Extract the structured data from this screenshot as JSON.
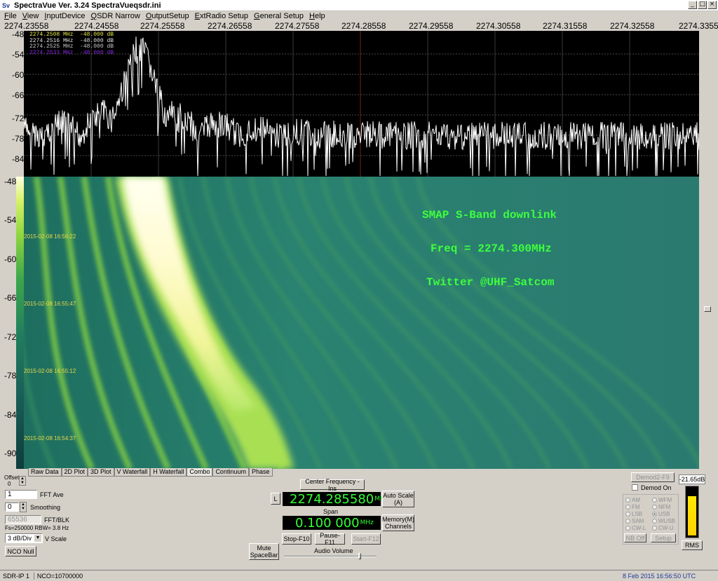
{
  "window": {
    "title": "SpectraVue Ver. 3.24  SpectraVueqsdr.ini",
    "icon_text": "Sv"
  },
  "menu": [
    "File",
    "View",
    "InputDevice",
    "QSDR Narrow",
    "OutputSetup",
    "ExtRadio Setup",
    "General Setup",
    "Help"
  ],
  "freq_axis": [
    "2274.23558",
    "2274.24558",
    "2274.25558",
    "2274.26558",
    "2274.27558",
    "2274.28558",
    "2274.29558",
    "2274.30558",
    "2274.31558",
    "2274.32558",
    "2274.3355"
  ],
  "spectrum": {
    "y_ticks": [
      "-48",
      "-54",
      "-60",
      "-66",
      "-72",
      "-78",
      "-84"
    ],
    "legend": [
      {
        "freq": "2274.2508 MHz",
        "level": "-48.000 dB",
        "color": "#e8e84a"
      },
      {
        "freq": "2274.2516 MHz",
        "level": "-48.000 dB",
        "color": "#e0e0e0"
      },
      {
        "freq": "2274.2525 MHz",
        "level": "-48.000 dB",
        "color": "#c8c8c8"
      },
      {
        "freq": "2274.2533 MHz",
        "level": "-48.000 dB",
        "color": "#8a2be2"
      }
    ]
  },
  "waterfall": {
    "y_ticks": [
      "-48",
      "-54",
      "-60",
      "-66",
      "-72",
      "-78",
      "-84",
      "-90"
    ],
    "timestamps": [
      "2015-02-08 16:56:22",
      "2015-02-08 16:55:47",
      "2015-02-08 16:55:12",
      "2015-02-08 16:54:37"
    ],
    "overlay": [
      "SMAP S-Band downlink",
      "Freq = 2274.300MHz",
      "Twitter @UHF_Satcom"
    ]
  },
  "tabs": [
    "Raw Data",
    "2D Plot",
    "3D Plot",
    "V Waterfall",
    "H Waterfall",
    "Combo",
    "Continuum",
    "Phase"
  ],
  "controls": {
    "offset_label": "Offset",
    "offset_value": "0",
    "fft_ave_value": "1",
    "fft_ave_label": "FFT Ave",
    "smoothing_value": "0",
    "smoothing_label": "Smoothing",
    "fft_blk_value": "65536",
    "fft_blk_label": "FFT/BLK",
    "fs_info": "Fs=250000 RBW= 3.8 Hz",
    "vscale_value": "3 dB/Div",
    "vscale_label": "V Scale",
    "nco_null": "NCO Null",
    "center_freq_button": "Center Frequency - Ins",
    "lock_button": "L",
    "center_freq": "2274.285580",
    "freq_unit": "MHz",
    "span_label": "Span",
    "span": "0.100 000",
    "auto_scale": [
      "Auto Scale",
      "(A)"
    ],
    "memory": [
      "Memory(M)",
      "Channels"
    ],
    "stop": "Stop-F10",
    "pause": "Pause-F11",
    "start": "Start-F12",
    "mute": [
      "Mute",
      "SpaceBar"
    ],
    "audio_volume": "Audio Volume",
    "demod2": "Demod2-F9",
    "demod_on": "Demod On",
    "modes_left": [
      "AM",
      "FM",
      "LSB",
      "SAM",
      "CW-L"
    ],
    "modes_right": [
      "WFM",
      "NFM",
      "USB",
      "WUSB",
      "CW-U"
    ],
    "selected_mode": "USB",
    "nb_off": "NB Off",
    "setup": "Setup",
    "level_readout": "-21.65dB",
    "rms": "RMS"
  },
  "status": {
    "device": "SDR-IP 1",
    "nco": "NCO=10700000",
    "datetime": "8 Feb 2015  16:56:50 UTC"
  }
}
